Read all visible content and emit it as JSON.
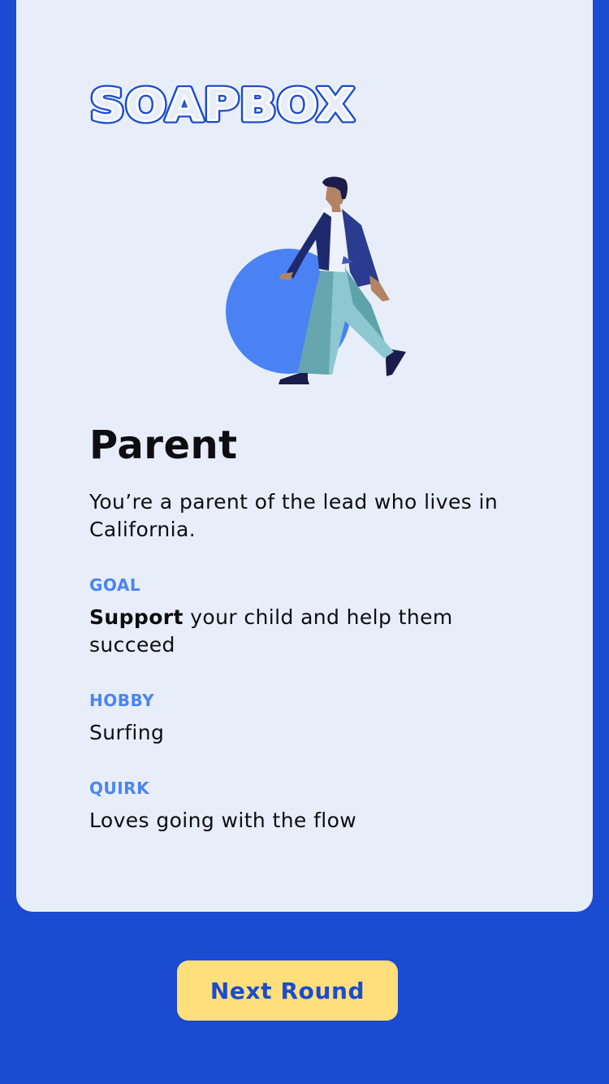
{
  "brand": {
    "logo_text": "SOAPBOX",
    "logo_color": "#1b4bd0"
  },
  "role": {
    "title": "Parent",
    "description": "You’re a parent of the lead who lives in California."
  },
  "goal": {
    "label": "GOAL",
    "emphasis": "Support",
    "rest": " your child and help them succeed"
  },
  "hobby": {
    "label": "HOBBY",
    "value": "Surfing"
  },
  "quirk": {
    "label": "QUIRK",
    "value": "Loves going with the flow"
  },
  "actions": {
    "next_label": "Next Round"
  },
  "colors": {
    "background": "#1b4bd0",
    "card": "#e8eef9",
    "accent_label": "#4a85f0",
    "button": "#ffdf7a",
    "button_text": "#1b4bd0"
  },
  "illustration": {
    "icon": "walking-person-illustration"
  }
}
